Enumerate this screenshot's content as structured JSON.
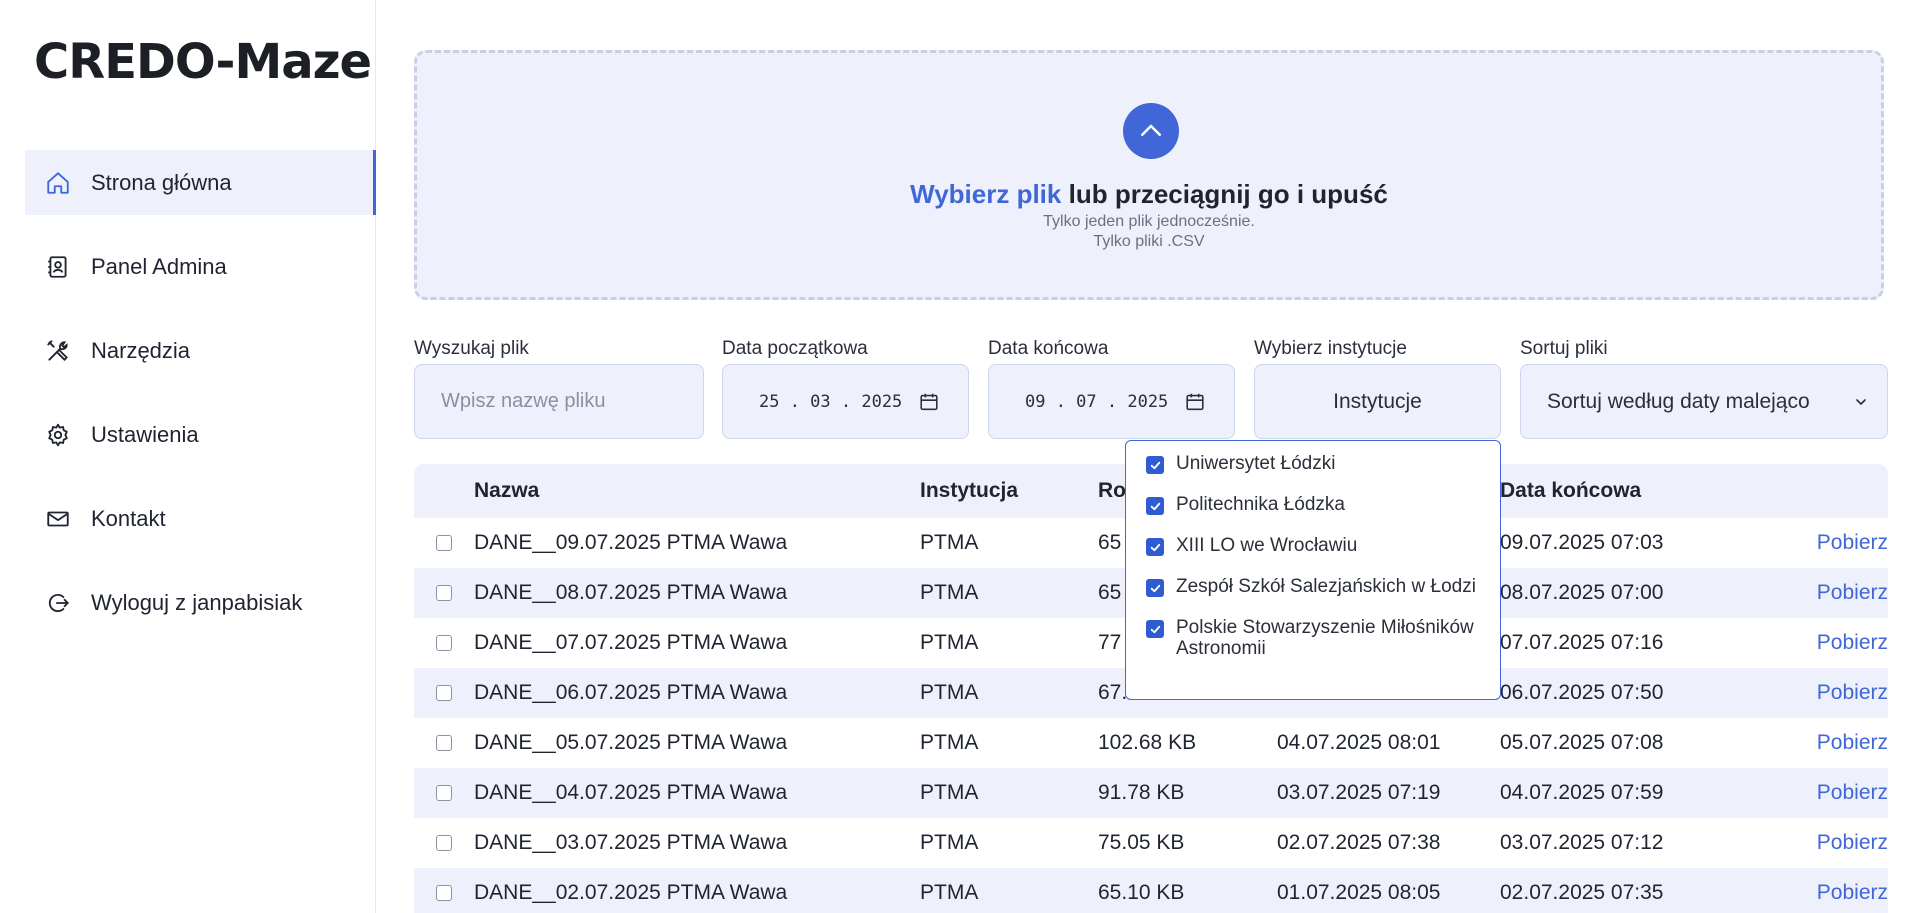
{
  "app": {
    "title": "CREDO-Maze"
  },
  "sidebar": {
    "items": [
      {
        "label": "Strona główna",
        "icon": "home-icon"
      },
      {
        "label": "Panel Admina",
        "icon": "admin-panel-icon"
      },
      {
        "label": "Narzędzia",
        "icon": "tools-icon"
      },
      {
        "label": "Ustawienia",
        "icon": "gear-icon"
      },
      {
        "label": "Kontakt",
        "icon": "mail-icon"
      },
      {
        "label": "Wyloguj z janpabisiak",
        "icon": "logout-icon"
      }
    ],
    "active": "Strona główna"
  },
  "upload": {
    "link_text": "Wybierz plik",
    "rest_text": "lub przeciągnij go i upuść",
    "note1": "Tylko jeden plik jednocześnie.",
    "note2": "Tylko pliki .CSV"
  },
  "filters": {
    "search_label": "Wyszukaj plik",
    "search_placeholder": "Wpisz nazwę pliku",
    "start_label": "Data początkowa",
    "start_value": "25 . 03 . 2025",
    "end_label": "Data końcowa",
    "end_value": "09 . 07 . 2025",
    "inst_label": "Wybierz instytucje",
    "inst_button": "Instytucje",
    "sort_label": "Sortuj pliki",
    "sort_value": "Sortuj według daty malejąco"
  },
  "institutions": [
    {
      "label": "Uniwersytet Łódzki",
      "checked": true
    },
    {
      "label": "Politechnika Łódzka",
      "checked": true
    },
    {
      "label": "XIII LO we Wrocławiu",
      "checked": true
    },
    {
      "label": "Zespół Szkół Salezjańskich w Łodzi",
      "checked": true
    },
    {
      "label": "Polskie Stowarzyszenie Miłośników Astronomii",
      "checked": true
    }
  ],
  "table": {
    "headers": {
      "name": "Nazwa",
      "inst": "Instytucja",
      "size": "Ro",
      "end": "Data końcowa"
    },
    "download_label": "Pobierz",
    "rows": [
      {
        "name": "DANE__09.07.2025 PTMA Wawa",
        "inst": "PTMA",
        "size": "65",
        "start": "",
        "end": "09.07.2025 07:03"
      },
      {
        "name": "DANE__08.07.2025 PTMA Wawa",
        "inst": "PTMA",
        "size": "65",
        "start": "",
        "end": "08.07.2025 07:00"
      },
      {
        "name": "DANE__07.07.2025 PTMA Wawa",
        "inst": "PTMA",
        "size": "77",
        "start": "",
        "end": "07.07.2025 07:16"
      },
      {
        "name": "DANE__06.07.2025 PTMA Wawa",
        "inst": "PTMA",
        "size": "67.",
        "start": "",
        "end": "06.07.2025 07:50"
      },
      {
        "name": "DANE__05.07.2025 PTMA Wawa",
        "inst": "PTMA",
        "size": "102.68 KB",
        "start": "04.07.2025 08:01",
        "end": "05.07.2025 07:08"
      },
      {
        "name": "DANE__04.07.2025 PTMA Wawa",
        "inst": "PTMA",
        "size": "91.78 KB",
        "start": "03.07.2025 07:19",
        "end": "04.07.2025 07:59"
      },
      {
        "name": "DANE__03.07.2025 PTMA Wawa",
        "inst": "PTMA",
        "size": "75.05 KB",
        "start": "02.07.2025 07:38",
        "end": "03.07.2025 07:12"
      },
      {
        "name": "DANE__02.07.2025 PTMA Wawa",
        "inst": "PTMA",
        "size": "65.10 KB",
        "start": "01.07.2025 08:05",
        "end": "02.07.2025 07:35"
      }
    ]
  },
  "colors": {
    "accent": "#4066d8",
    "panel": "#eef1fb",
    "border": "#cdd5ec"
  }
}
